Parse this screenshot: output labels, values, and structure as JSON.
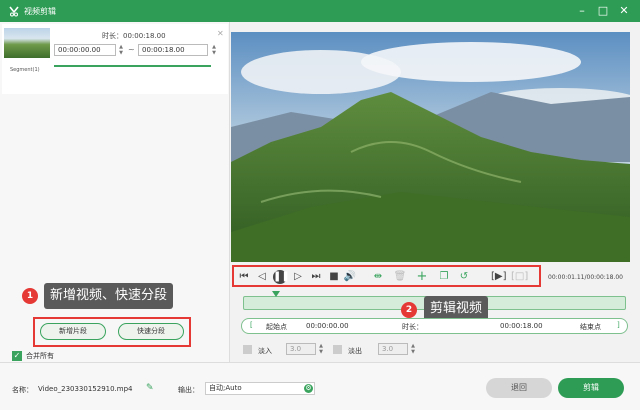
{
  "window": {
    "title": "视频剪辑"
  },
  "segment": {
    "label": "Segment(1)",
    "duration_label": "时长：00:00:18.00",
    "start": "00:00:00.00",
    "end": "00:00:18.00",
    "tilde": "~"
  },
  "annotations": {
    "one_num": "1",
    "one_text": "新增视频、快速分段",
    "two_num": "2",
    "two_text": "剪辑视频"
  },
  "left_buttons": {
    "add_segment": "新增片段",
    "quick_split": "快速分段"
  },
  "merge": {
    "label": "合并所有",
    "checked": true
  },
  "player": {
    "time_readout": "00:00:01.11/00:00:18.00"
  },
  "range": {
    "start_btn": "起始点",
    "start_value": "00:00:00.00",
    "duration_label": "时长：",
    "end_value": "00:00:18.00",
    "end_btn": "结束点"
  },
  "fade": {
    "in_label": "淡入",
    "in_value": "3.0",
    "out_label": "淡出",
    "out_value": "3.0"
  },
  "bottom": {
    "name_label": "名称：",
    "file_name": "Video_230330152910.mp4",
    "output_label": "输出：",
    "output_value": "自动;Auto",
    "cancel": "退回",
    "cut": "剪辑"
  },
  "colors": {
    "brand": "#2e9c55",
    "annotation_red": "#e53935"
  }
}
